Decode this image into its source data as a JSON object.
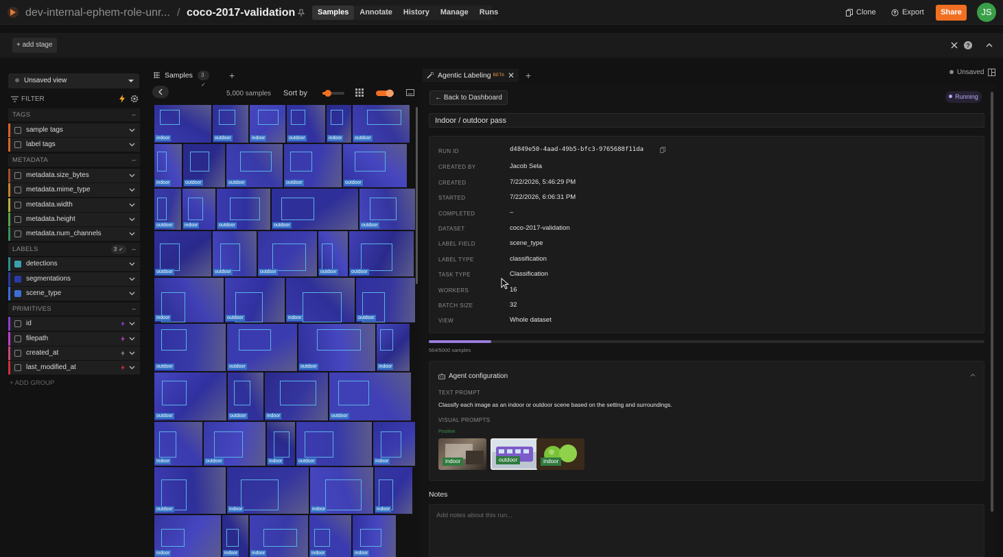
{
  "header": {
    "dataset_parent": "dev-internal-ephem-role-unr...",
    "separator": "/",
    "dataset_name": "coco-2017-validation",
    "nav_tabs": [
      "Samples",
      "Annotate",
      "History",
      "Manage",
      "Runs"
    ],
    "active_tab": "Samples",
    "clone_label": "Clone",
    "export_label": "Export",
    "share_label": "Share",
    "avatar_initials": "JS"
  },
  "stage_bar": {
    "add_stage_label": "+ add stage"
  },
  "sidebar": {
    "view_select": "Unsaved view",
    "filter_label": "FILTER",
    "groups": {
      "tags": "TAGS",
      "metadata": "METADATA",
      "labels": "LABELS",
      "labels_badge": "3 ✓",
      "primitives": "PRIMITIVES"
    },
    "tags_fields": [
      "sample tags",
      "label tags"
    ],
    "metadata_fields": [
      "metadata.size_bytes",
      "metadata.mime_type",
      "metadata.width",
      "metadata.height",
      "metadata.num_channels"
    ],
    "label_fields": [
      "detections",
      "segmentations",
      "scene_type"
    ],
    "primitive_fields": [
      "id",
      "filepath",
      "created_at",
      "last_modified_at"
    ],
    "add_group_label": "+ ADD GROUP"
  },
  "samples_panel": {
    "tab_label": "Samples",
    "tab_badge": "3 ✓",
    "sample_count": "5,000 samples",
    "sort_by_label": "Sort by",
    "tile_rows": [
      [
        "indoor",
        "outdoor",
        "indoor",
        "outdoor",
        "indoor",
        "outdoor"
      ],
      [
        "indoor",
        "outdoor",
        "outdoor",
        "outdoor",
        "outdoor"
      ],
      [
        "outdoor",
        "indoor",
        "outdoor",
        "outdoor",
        "outdoor"
      ],
      [
        "outdoor",
        "outdoor",
        "outdoor",
        "outdoor",
        "outdoor"
      ],
      [
        "indoor",
        "outdoor",
        "indoor",
        "outdoor"
      ],
      [
        "outdoor",
        "outdoor",
        "outdoor",
        "indoor"
      ],
      [
        "outdoor",
        "outdoor",
        "indoor",
        "outdoor"
      ],
      [
        "indoor",
        "outdoor",
        "indoor",
        "outdoor",
        "indoor"
      ],
      [
        "outdoor",
        "indoor",
        "indoor",
        "indoor"
      ],
      [
        "indoor",
        "indoor",
        "indoor",
        "indoor",
        "indoor"
      ]
    ]
  },
  "right_panel": {
    "tab_label": "Agentic Labeling",
    "tab_beta": "BETA",
    "unsaved_label": "Unsaved",
    "back_label": "← Back to Dashboard",
    "status": "Running",
    "run_name": "Indoor / outdoor pass",
    "details": [
      {
        "key": "RUN ID",
        "value": "d4849e50-4aad-49b5-bfc3-9765688f11da"
      },
      {
        "key": "CREATED BY",
        "value": "Jacob Sela"
      },
      {
        "key": "CREATED",
        "value": "7/22/2026, 5:46:29 PM"
      },
      {
        "key": "STARTED",
        "value": "7/22/2026, 6:06:31 PM"
      },
      {
        "key": "COMPLETED",
        "value": "–"
      },
      {
        "key": "DATASET",
        "value": "coco-2017-validation"
      },
      {
        "key": "LABEL FIELD",
        "value": "scene_type"
      },
      {
        "key": "LABEL TYPE",
        "value": "classification"
      },
      {
        "key": "TASK TYPE",
        "value": "Classification"
      },
      {
        "key": "WORKERS",
        "value": "16"
      },
      {
        "key": "BATCH SIZE",
        "value": "32"
      },
      {
        "key": "VIEW",
        "value": "Whole dataset"
      }
    ],
    "progress_fraction": 0.1128,
    "progress_text": "564/5000 samples",
    "agent_config": {
      "title": "Agent configuration",
      "text_prompt_label": "TEXT PROMPT",
      "text_prompt": "Classify each image as an indoor or outdoor scene based on the setting and surroundings.",
      "visual_prompts_label": "VISUAL PROMPTS",
      "positive_label": "Positive",
      "visual_prompts": [
        "indoor",
        "outdoor",
        "indoor"
      ]
    },
    "notes_title": "Notes",
    "notes_placeholder": "Add notes about this run..."
  },
  "colors": {
    "accent_orange": "#f26f22",
    "avatar_green": "#3aa048",
    "progress_purple": "#9a7de0",
    "tile_blue": "#3a3aa8"
  }
}
